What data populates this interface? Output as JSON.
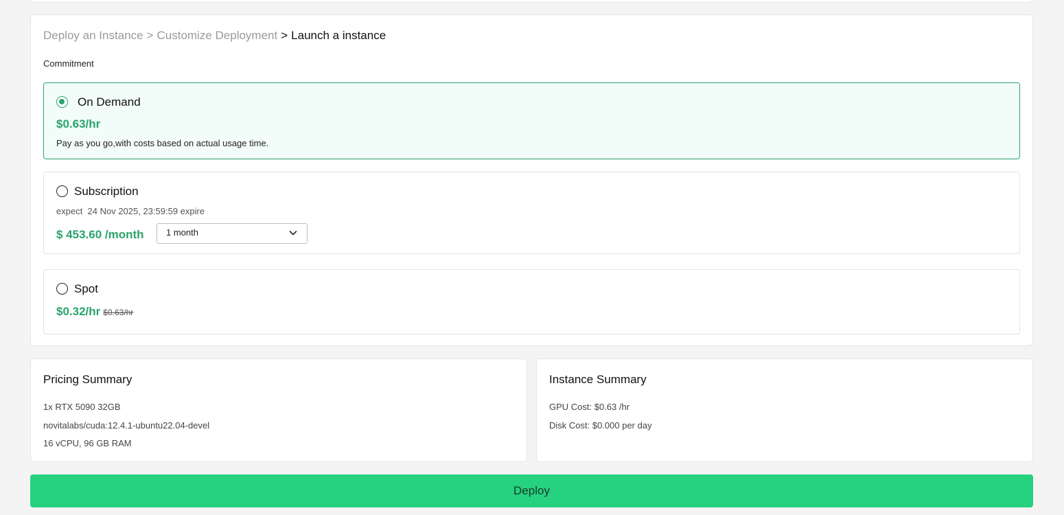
{
  "breadcrumb": {
    "step1": "Deploy an Instance",
    "step2": "Customize Deployment",
    "current": "Launch a instance",
    "separator": ">"
  },
  "commitment": {
    "label": "Commitment",
    "options": [
      {
        "title": "On Demand",
        "price": "$0.63/hr",
        "description": "Pay as you go,with costs based on actual usage time.",
        "selected": true
      },
      {
        "title": "Subscription",
        "expire_text": "expect  24 Nov 2025, 23:59:59 expire",
        "price": "$ 453.60 /month",
        "duration_selected": "1 month",
        "selected": false
      },
      {
        "title": "Spot",
        "price": "$0.32/hr",
        "original_price": "$0.63/hr",
        "selected": false
      }
    ]
  },
  "pricing_summary": {
    "title": "Pricing Summary",
    "lines": [
      "1x RTX 5090 32GB",
      "novitalabs/cuda:12.4.1-ubuntu22.04-devel",
      "16 vCPU, 96 GB RAM"
    ]
  },
  "instance_summary": {
    "title": "Instance Summary",
    "lines": [
      "GPU Cost: $0.63 /hr",
      "Disk Cost: $0.000 per day"
    ]
  },
  "deploy_button": "Deploy",
  "colors": {
    "accent": "#2aa36b",
    "deploy_bg": "#26d17f",
    "selected_bg": "#f2fcf8"
  },
  "icons": {
    "dropdown": "chevron-down-icon"
  }
}
